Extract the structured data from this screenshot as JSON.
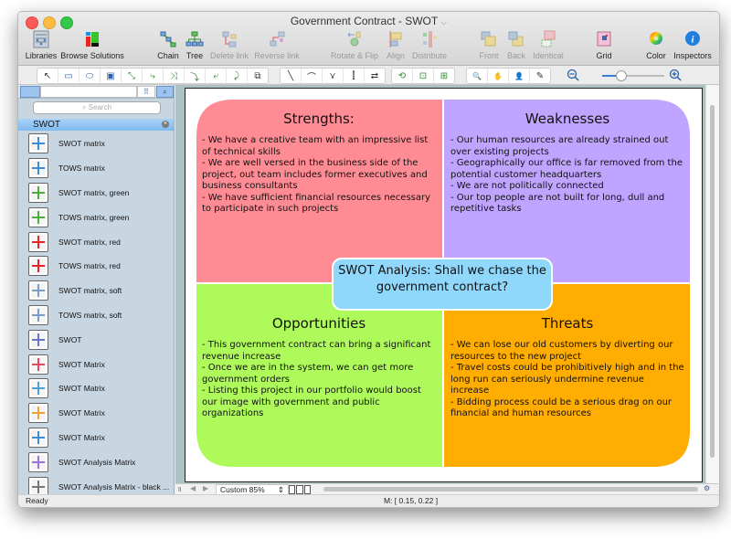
{
  "window": {
    "title": "Government Contract - SWOT",
    "title_chevron": "⌵"
  },
  "toolbar": {
    "buttons": [
      {
        "label": "Libraries",
        "icon": "libraries-icon",
        "enabled": true
      },
      {
        "label": "Browse Solutions",
        "icon": "browse-solutions-icon",
        "enabled": true
      },
      {
        "label": "Chain",
        "icon": "chain-icon",
        "enabled": true
      },
      {
        "label": "Tree",
        "icon": "tree-icon",
        "enabled": true
      },
      {
        "label": "Delete link",
        "icon": "delete-link-icon",
        "enabled": false
      },
      {
        "label": "Reverse link",
        "icon": "reverse-link-icon",
        "enabled": false
      },
      {
        "label": "Rotate & Flip",
        "icon": "rotate-flip-icon",
        "enabled": false
      },
      {
        "label": "Align",
        "icon": "align-icon",
        "enabled": false
      },
      {
        "label": "Distribute",
        "icon": "distribute-icon",
        "enabled": false
      },
      {
        "label": "Front",
        "icon": "front-icon",
        "enabled": false
      },
      {
        "label": "Back",
        "icon": "back-icon",
        "enabled": false
      },
      {
        "label": "Identical",
        "icon": "identical-icon",
        "enabled": false
      },
      {
        "label": "Grid",
        "icon": "grid-icon",
        "enabled": true
      },
      {
        "label": "Color",
        "icon": "color-wheel-icon",
        "enabled": true
      },
      {
        "label": "Inspectors",
        "icon": "info-icon",
        "enabled": true
      }
    ]
  },
  "drawing_tools": {
    "group1": [
      "↖",
      "▭",
      "⬭",
      "▣",
      "⤡",
      "⤷",
      "⤨",
      "⤵",
      "⤶",
      "⤸",
      "⧉"
    ],
    "group2": [
      "╲",
      "⌒",
      "⋎",
      "⫿",
      "⇄"
    ],
    "group3": [
      "⟲",
      "⊡",
      "⊞"
    ],
    "group4": [
      "🔍",
      "✋",
      "👤",
      "✎"
    ],
    "zoom_level": 0.3
  },
  "sidebar": {
    "search_placeholder": "Search",
    "section_title": "SWOT",
    "items": [
      {
        "label": "SWOT matrix",
        "color": "#3b8fd8"
      },
      {
        "label": "TOWS matrix",
        "color": "#3b8fd8"
      },
      {
        "label": "SWOT matrix, green",
        "color": "#4caf3a"
      },
      {
        "label": "TOWS matrix, green",
        "color": "#4caf3a"
      },
      {
        "label": "SWOT matrix, red",
        "color": "#e8242a"
      },
      {
        "label": "TOWS matrix, red",
        "color": "#e8242a"
      },
      {
        "label": "SWOT matrix, soft",
        "color": "#7a9cc8"
      },
      {
        "label": "TOWS matrix, soft",
        "color": "#7a9cc8"
      },
      {
        "label": "SWOT",
        "color": "#6a72c8"
      },
      {
        "label": "SWOT Matrix",
        "color": "#e84a5f"
      },
      {
        "label": "SWOT Matrix",
        "color": "#4aa3d8"
      },
      {
        "label": "SWOT Matrix",
        "color": "#f2a13a"
      },
      {
        "label": "SWOT Matrix",
        "color": "#3b8fd8"
      },
      {
        "label": "SWOT Analysis Matrix",
        "color": "#a070d8"
      },
      {
        "label": "SWOT Analysis Matrix - black ...",
        "color": "#777777"
      }
    ]
  },
  "diagram": {
    "center": "SWOT Analysis: Shall we chase the government contract?",
    "center_color": "#8fd8fb",
    "quadrants": [
      {
        "key": "strengths",
        "title": "Strengths:",
        "color": "#ff8c94",
        "lines": [
          "- We have a creative team with an impressive list of technical skills",
          "- We are well versed in the business side of the project, out team includes former executives and business consultants",
          "- We have sufficient financial resources necessary to participate in such projects"
        ]
      },
      {
        "key": "weaknesses",
        "title": "Weaknesses",
        "color": "#bfa5ff",
        "lines": [
          "- Our human resources are already strained out over existing projects",
          "- Geographically our office is far removed from the potential customer headquarters",
          "- We are not politically connected",
          "- Our top people are not built for long, dull and repetitive tasks"
        ]
      },
      {
        "key": "opportunities",
        "title": "Opportunities",
        "color": "#aefa5a",
        "lines": [
          "- This government contract can bring a significant revenue increase",
          "- Once we are in the system, we can get more government orders",
          "- Listing this project in our portfolio would boost our image with government and public organizations"
        ]
      },
      {
        "key": "threats",
        "title": "Threats",
        "color": "#ffad00",
        "lines": [
          "- We can lose our old customers by diverting our resources to the new project",
          "- Travel costs could be prohibitively high and in the long run can seriously undermine revenue increase",
          "- Bidding process could be a serious drag on our financial and human resources"
        ]
      }
    ]
  },
  "bottombar": {
    "zoom_select": "Custom 85%"
  },
  "status": {
    "left": "Ready",
    "mouse": "M: [ 0.15, 0.22 ]"
  }
}
